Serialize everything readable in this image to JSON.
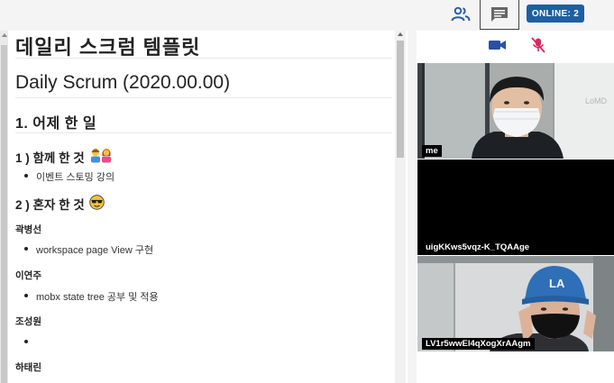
{
  "toolbar": {
    "online_label": "ONLINE: 2",
    "users_icon": "users-icon",
    "chat_icon": "chat-icon"
  },
  "document": {
    "title": "데일리 스크럼 템플릿",
    "h1": "Daily Scrum (2020.00.00)",
    "section1": "1. 어제 한 일",
    "sub1": "1 ) 함께 한 것",
    "sub1_item": "이벤트 스토밍 강의",
    "sub2": "2 ) 혼자 한 것",
    "people": [
      {
        "name": "곽병선",
        "item": "workspace page View 구현"
      },
      {
        "name": "이연주",
        "item": "mobx state tree 공부 및 적용"
      },
      {
        "name": "조성원",
        "item": ""
      },
      {
        "name": "하태린",
        "item": ""
      }
    ]
  },
  "video": {
    "controls": {
      "camera_icon": "video-camera-icon",
      "mic_icon": "mic-off-icon"
    },
    "participants": [
      {
        "label": "me"
      },
      {
        "label": "uigKKws5vqz-K_TQAAge"
      },
      {
        "label": "LV1r5wwEl4qXogXrAAgm"
      }
    ]
  },
  "colors": {
    "badge": "#1f5fa0",
    "accent_icon": "#2a4fa8",
    "mic_off": "#e0245e"
  }
}
